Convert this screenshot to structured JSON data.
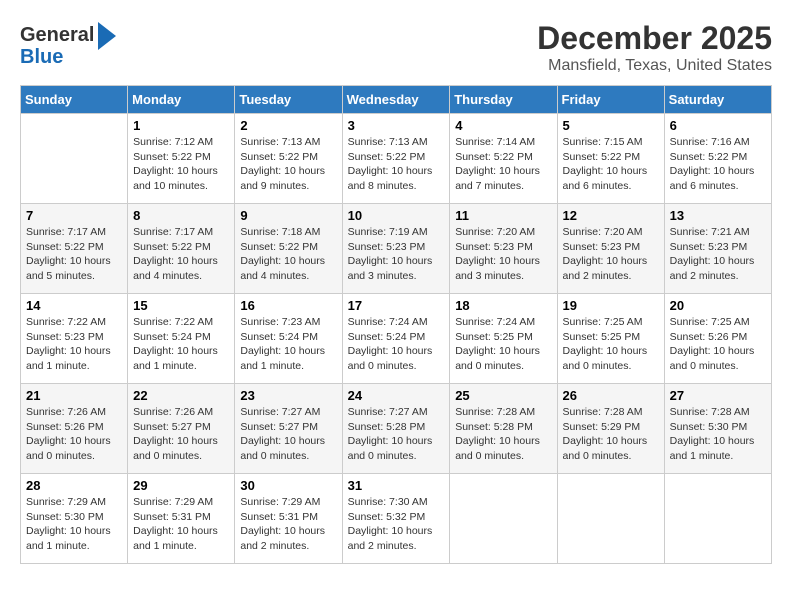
{
  "header": {
    "logo_line1": "General",
    "logo_line2": "Blue",
    "month": "December 2025",
    "location": "Mansfield, Texas, United States"
  },
  "days_of_week": [
    "Sunday",
    "Monday",
    "Tuesday",
    "Wednesday",
    "Thursday",
    "Friday",
    "Saturday"
  ],
  "weeks": [
    [
      {
        "day": "",
        "info": ""
      },
      {
        "day": "1",
        "info": "Sunrise: 7:12 AM\nSunset: 5:22 PM\nDaylight: 10 hours\nand 10 minutes."
      },
      {
        "day": "2",
        "info": "Sunrise: 7:13 AM\nSunset: 5:22 PM\nDaylight: 10 hours\nand 9 minutes."
      },
      {
        "day": "3",
        "info": "Sunrise: 7:13 AM\nSunset: 5:22 PM\nDaylight: 10 hours\nand 8 minutes."
      },
      {
        "day": "4",
        "info": "Sunrise: 7:14 AM\nSunset: 5:22 PM\nDaylight: 10 hours\nand 7 minutes."
      },
      {
        "day": "5",
        "info": "Sunrise: 7:15 AM\nSunset: 5:22 PM\nDaylight: 10 hours\nand 6 minutes."
      },
      {
        "day": "6",
        "info": "Sunrise: 7:16 AM\nSunset: 5:22 PM\nDaylight: 10 hours\nand 6 minutes."
      }
    ],
    [
      {
        "day": "7",
        "info": "Sunrise: 7:17 AM\nSunset: 5:22 PM\nDaylight: 10 hours\nand 5 minutes."
      },
      {
        "day": "8",
        "info": "Sunrise: 7:17 AM\nSunset: 5:22 PM\nDaylight: 10 hours\nand 4 minutes."
      },
      {
        "day": "9",
        "info": "Sunrise: 7:18 AM\nSunset: 5:22 PM\nDaylight: 10 hours\nand 4 minutes."
      },
      {
        "day": "10",
        "info": "Sunrise: 7:19 AM\nSunset: 5:23 PM\nDaylight: 10 hours\nand 3 minutes."
      },
      {
        "day": "11",
        "info": "Sunrise: 7:20 AM\nSunset: 5:23 PM\nDaylight: 10 hours\nand 3 minutes."
      },
      {
        "day": "12",
        "info": "Sunrise: 7:20 AM\nSunset: 5:23 PM\nDaylight: 10 hours\nand 2 minutes."
      },
      {
        "day": "13",
        "info": "Sunrise: 7:21 AM\nSunset: 5:23 PM\nDaylight: 10 hours\nand 2 minutes."
      }
    ],
    [
      {
        "day": "14",
        "info": "Sunrise: 7:22 AM\nSunset: 5:23 PM\nDaylight: 10 hours\nand 1 minute."
      },
      {
        "day": "15",
        "info": "Sunrise: 7:22 AM\nSunset: 5:24 PM\nDaylight: 10 hours\nand 1 minute."
      },
      {
        "day": "16",
        "info": "Sunrise: 7:23 AM\nSunset: 5:24 PM\nDaylight: 10 hours\nand 1 minute."
      },
      {
        "day": "17",
        "info": "Sunrise: 7:24 AM\nSunset: 5:24 PM\nDaylight: 10 hours\nand 0 minutes."
      },
      {
        "day": "18",
        "info": "Sunrise: 7:24 AM\nSunset: 5:25 PM\nDaylight: 10 hours\nand 0 minutes."
      },
      {
        "day": "19",
        "info": "Sunrise: 7:25 AM\nSunset: 5:25 PM\nDaylight: 10 hours\nand 0 minutes."
      },
      {
        "day": "20",
        "info": "Sunrise: 7:25 AM\nSunset: 5:26 PM\nDaylight: 10 hours\nand 0 minutes."
      }
    ],
    [
      {
        "day": "21",
        "info": "Sunrise: 7:26 AM\nSunset: 5:26 PM\nDaylight: 10 hours\nand 0 minutes."
      },
      {
        "day": "22",
        "info": "Sunrise: 7:26 AM\nSunset: 5:27 PM\nDaylight: 10 hours\nand 0 minutes."
      },
      {
        "day": "23",
        "info": "Sunrise: 7:27 AM\nSunset: 5:27 PM\nDaylight: 10 hours\nand 0 minutes."
      },
      {
        "day": "24",
        "info": "Sunrise: 7:27 AM\nSunset: 5:28 PM\nDaylight: 10 hours\nand 0 minutes."
      },
      {
        "day": "25",
        "info": "Sunrise: 7:28 AM\nSunset: 5:28 PM\nDaylight: 10 hours\nand 0 minutes."
      },
      {
        "day": "26",
        "info": "Sunrise: 7:28 AM\nSunset: 5:29 PM\nDaylight: 10 hours\nand 0 minutes."
      },
      {
        "day": "27",
        "info": "Sunrise: 7:28 AM\nSunset: 5:30 PM\nDaylight: 10 hours\nand 1 minute."
      }
    ],
    [
      {
        "day": "28",
        "info": "Sunrise: 7:29 AM\nSunset: 5:30 PM\nDaylight: 10 hours\nand 1 minute."
      },
      {
        "day": "29",
        "info": "Sunrise: 7:29 AM\nSunset: 5:31 PM\nDaylight: 10 hours\nand 1 minute."
      },
      {
        "day": "30",
        "info": "Sunrise: 7:29 AM\nSunset: 5:31 PM\nDaylight: 10 hours\nand 2 minutes."
      },
      {
        "day": "31",
        "info": "Sunrise: 7:30 AM\nSunset: 5:32 PM\nDaylight: 10 hours\nand 2 minutes."
      },
      {
        "day": "",
        "info": ""
      },
      {
        "day": "",
        "info": ""
      },
      {
        "day": "",
        "info": ""
      }
    ]
  ]
}
